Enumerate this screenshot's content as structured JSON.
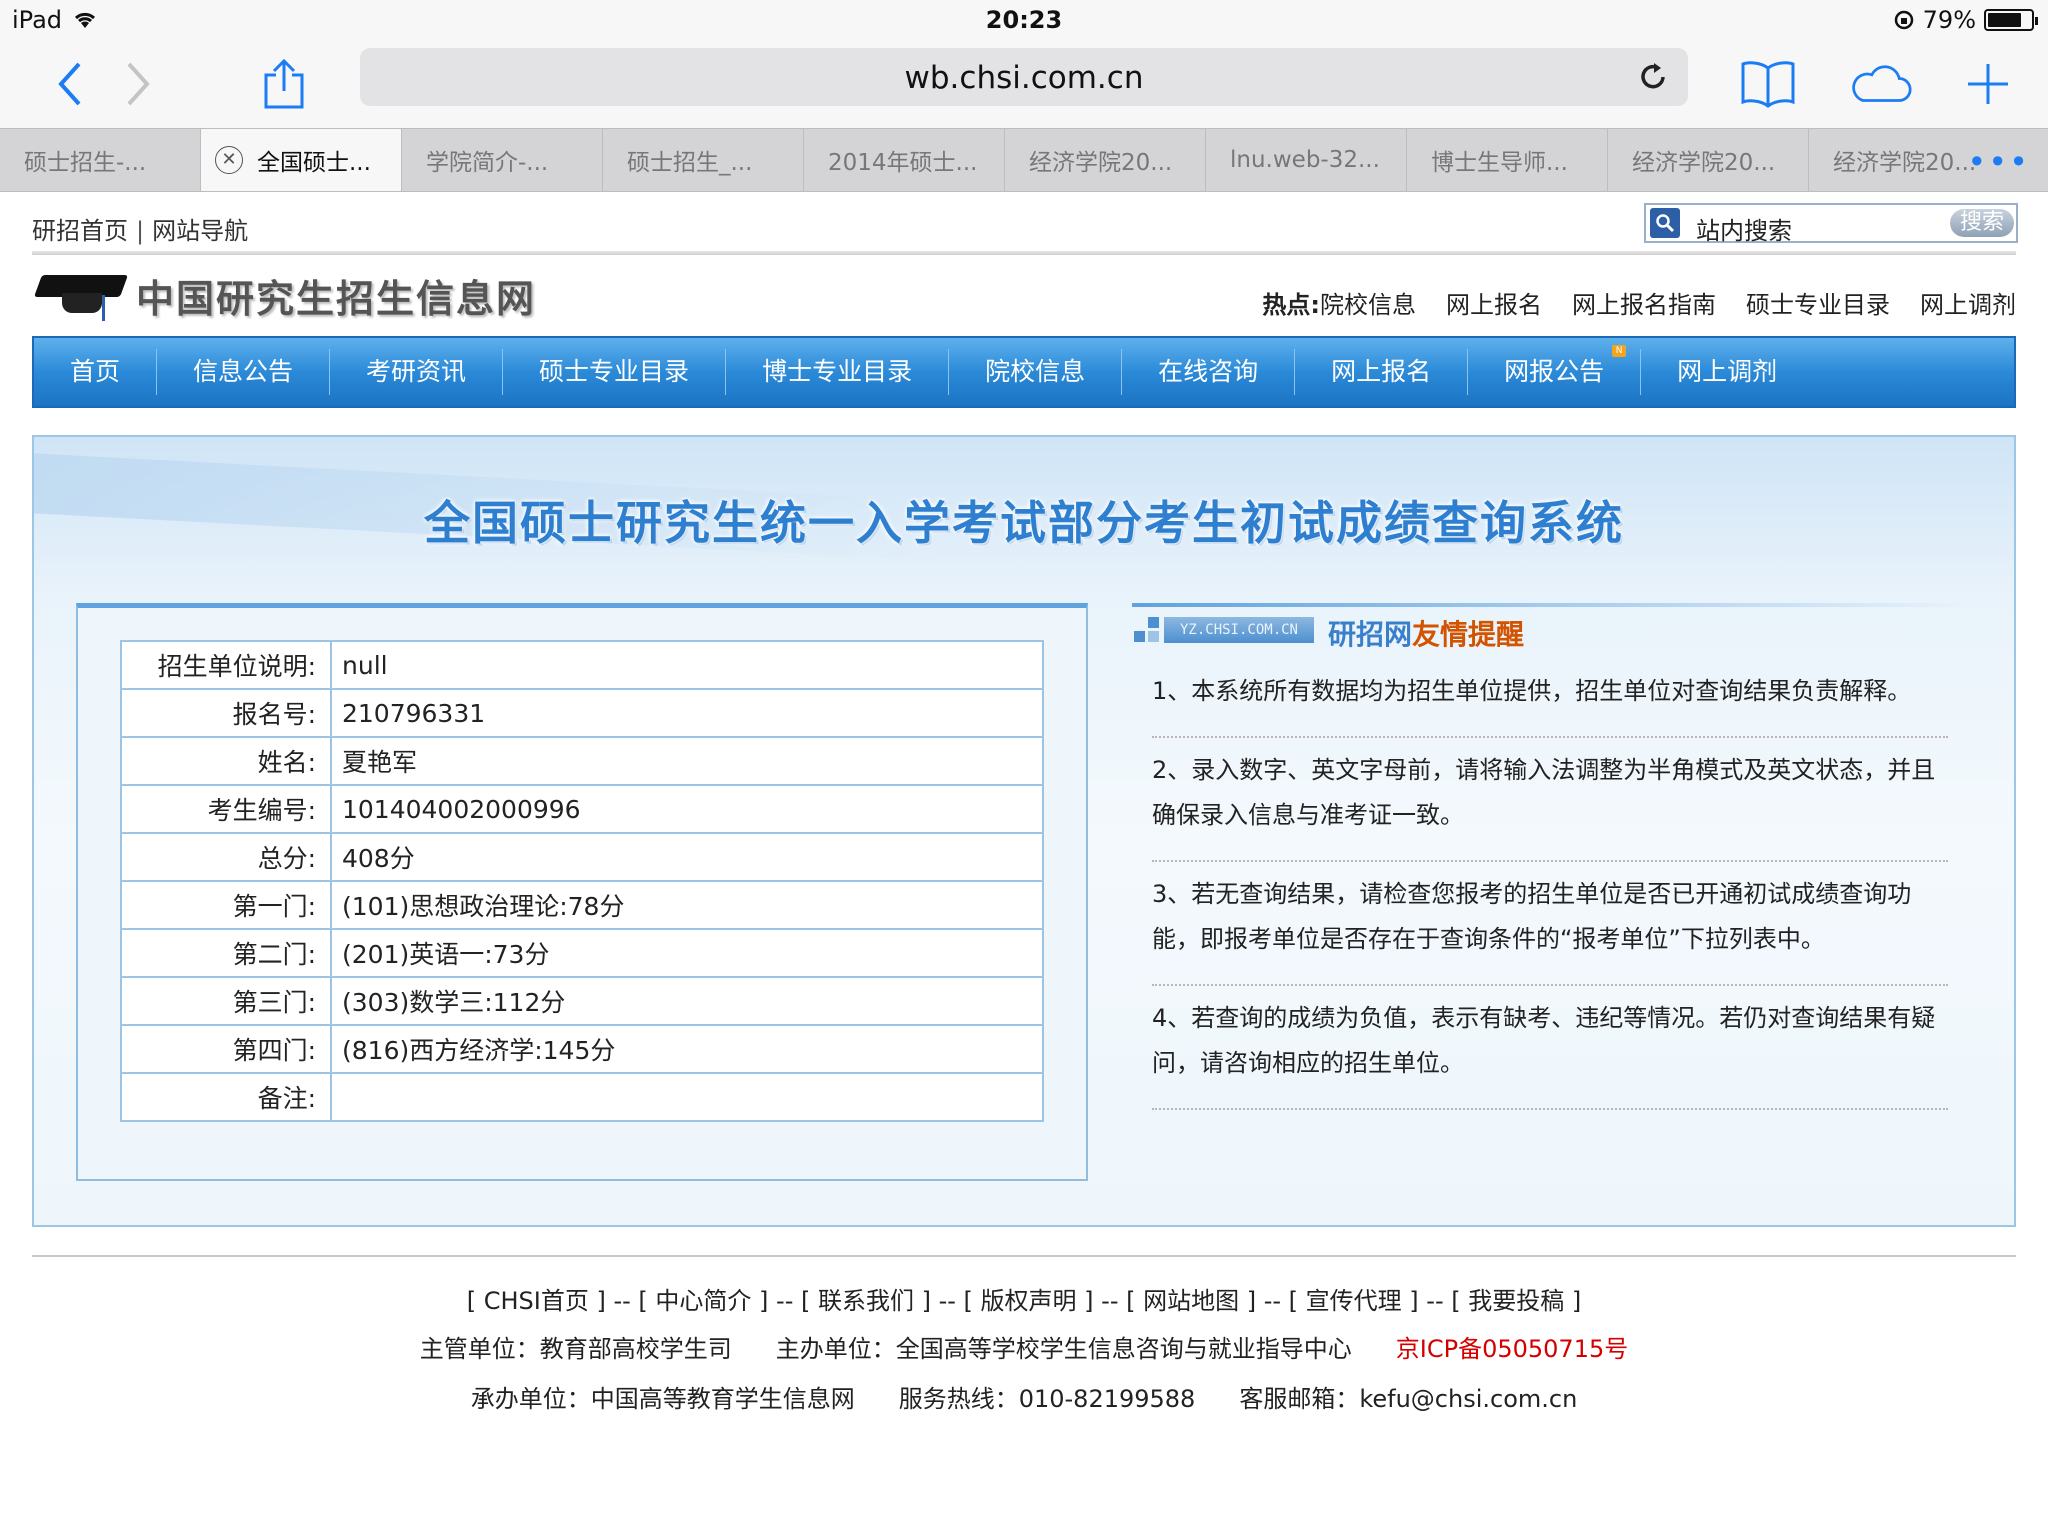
{
  "status_bar": {
    "device": "iPad",
    "time": "20:23",
    "battery": "79%",
    "battery_level": 0.79
  },
  "browser": {
    "url": "wb.chsi.com.cn",
    "tabs": [
      "硕士招生-...",
      "全国硕士...",
      "学院简介-...",
      "硕士招生_...",
      "2014年硕士...",
      "经济学院20...",
      "lnu.web-32...",
      "博士生导师...",
      "经济学院20...",
      "经济学院20..."
    ],
    "tab_more": "•••"
  },
  "site": {
    "top_links": [
      "研招首页",
      "网站导航"
    ],
    "top_sep": "|",
    "search_placeholder": "站内搜索",
    "search_button": "搜索",
    "logo_text": "中国研究生招生信息网",
    "hot_label": "热点:",
    "hot_links": [
      "院校信息",
      "网上报名",
      "网上报名指南",
      "硕士专业目录",
      "网上调剂"
    ],
    "nav": [
      "首页",
      "信息公告",
      "考研资讯",
      "硕士专业目录",
      "博士专业目录",
      "院校信息",
      "在线咨询",
      "网上报名",
      "网报公告",
      "网上调剂"
    ],
    "nav_badge": "N"
  },
  "banner_title": "全国硕士研究生统一入学考试部分考生初试成绩查询系统",
  "result": [
    {
      "label": "招生单位说明:",
      "value": "null"
    },
    {
      "label": "报名号:",
      "value": "210796331"
    },
    {
      "label": "姓名:",
      "value": "夏艳军"
    },
    {
      "label": "考生编号:",
      "value": "101404002000996"
    },
    {
      "label": "总分:",
      "value": "408分"
    },
    {
      "label": "第一门:",
      "value": "(101)思想政治理论:78分"
    },
    {
      "label": "第二门:",
      "value": "(201)英语一:73分"
    },
    {
      "label": "第三门:",
      "value": "(303)数学三:112分"
    },
    {
      "label": "第四门:",
      "value": "(816)西方经济学:145分"
    },
    {
      "label": "备注:",
      "value": ""
    }
  ],
  "tips": {
    "tag": "YZ.CHSI.COM.CN",
    "title_part1": "研招网",
    "title_part2": "友情提醒",
    "items": [
      "1、本系统所有数据均为招生单位提供，招生单位对查询结果负责解释。",
      "2、录入数字、英文字母前，请将输入法调整为半角模式及英文状态，并且确保录入信息与准考证一致。",
      "3、若无查询结果，请检查您报考的招生单位是否已开通初试成绩查询功能，即报考单位是否存在于查询条件的“报考单位”下拉列表中。",
      "4、若查询的成绩为负值，表示有缺考、违纪等情况。若仍对查询结果有疑问，请咨询相应的招生单位。"
    ]
  },
  "footer": {
    "links_line": "[ CHSI首页 ] -- [ 中心简介 ] -- [ 联系我们 ] -- [ 版权声明 ] -- [ 网站地图 ] -- [ 宣传代理 ] -- [ 我要投稿 ]",
    "supervisor": "主管单位：教育部高校学生司",
    "host": "主办单位：全国高等学校学生信息咨询与就业指导中心",
    "icp": "京ICP备05050715号",
    "operator": "承办单位：中国高等教育学生信息网",
    "hotline": "服务热线：010-82199588",
    "email": "客服邮箱：kefu@chsi.com.cn"
  },
  "colors": {
    "accent": "#1b7cf4",
    "nav_blue": "#2b8ad8",
    "banner_title": "#2f7fd0",
    "icp_red": "#d40000",
    "tip_orange": "#d35400"
  }
}
